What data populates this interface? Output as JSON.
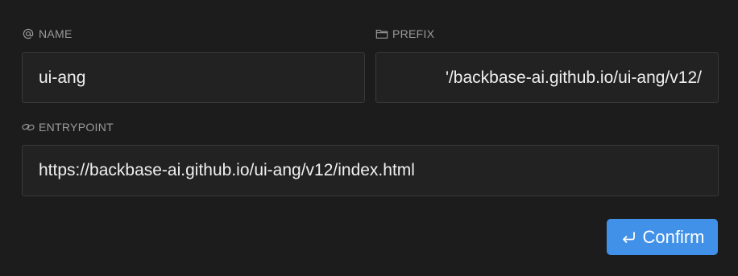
{
  "fields": {
    "name": {
      "label": "NAME",
      "label_icon": "at-sign-icon",
      "value": "ui-ang"
    },
    "prefix": {
      "label": "PREFIX",
      "label_icon": "folder-icon",
      "value": "'/backbase-ai.github.io/ui-ang/v12/"
    },
    "entrypoint": {
      "label": "ENTRYPOINT",
      "label_icon": "link-icon",
      "value": "https://backbase-ai.github.io/ui-ang/v12/index.html"
    }
  },
  "actions": {
    "confirm_label": "Confirm",
    "confirm_icon": "enter-return-icon"
  },
  "colors": {
    "background": "#1c1c1c",
    "input_background": "#222222",
    "input_border": "#3a3a3a",
    "label_text": "#9a9a9a",
    "accent": "#4191e8"
  }
}
